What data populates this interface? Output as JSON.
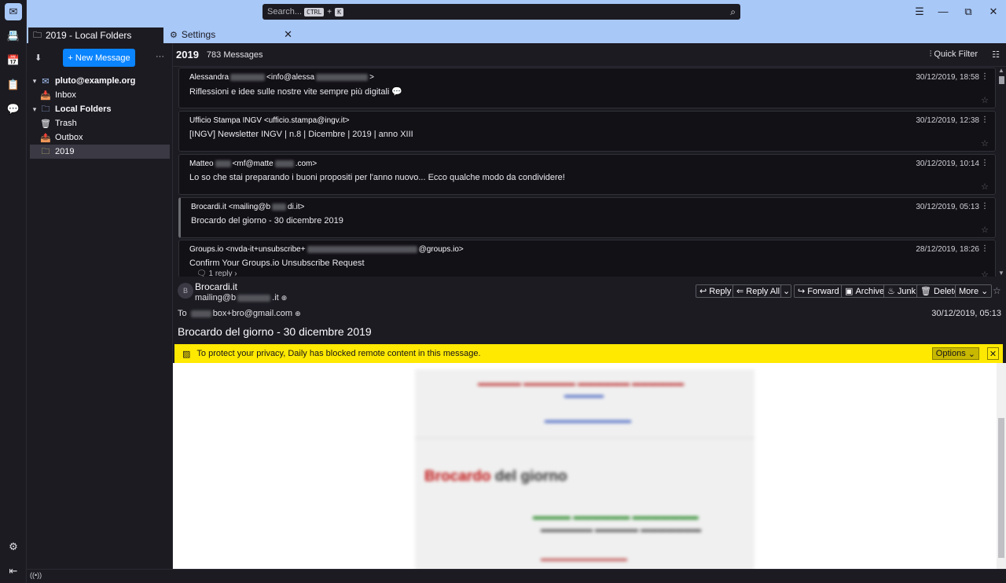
{
  "window": {
    "search_placeholder": "Search...",
    "shortcut_ctrl": "CTRL",
    "shortcut_plus": "+",
    "shortcut_key": "K",
    "menu_icon": "☰",
    "min_icon": "—",
    "max_icon": "⧉",
    "close_icon": "✕"
  },
  "spaces": {
    "mail": "✉",
    "address_book": "📇",
    "calendar": "📅",
    "tasks": "📋",
    "chat": "💬",
    "settings": "⚙",
    "collapse": "⇤"
  },
  "tabs": [
    {
      "label": "2019 - Local Folders",
      "icon": "🗀"
    },
    {
      "label": "Settings",
      "icon": "⚙",
      "close": "✕"
    }
  ],
  "folderpane": {
    "get_messages_icon": "⬇",
    "new_message": "+ New Message",
    "more": "···",
    "folders": [
      {
        "label": "pluto@example.org",
        "icon": "✉",
        "twisty": "▾",
        "bold": true
      },
      {
        "label": "Inbox",
        "icon": "📥",
        "twisty": "",
        "bold": false
      },
      {
        "label": "Local Folders",
        "icon": "🗀",
        "twisty": "▾",
        "bold": true
      },
      {
        "label": "Trash",
        "icon": "🗑",
        "twisty": "",
        "bold": false
      },
      {
        "label": "Outbox",
        "icon": "📤",
        "twisty": "",
        "bold": false
      },
      {
        "label": "2019",
        "icon": "🗀",
        "twisty": "",
        "bold": false
      }
    ]
  },
  "threadpane": {
    "folder_name": "2019",
    "count": "783 Messages",
    "quick_filter": "Quick Filter",
    "messages": [
      {
        "from_a": "Alessandra",
        "from_b": "<info@alessa",
        "from_c": ">",
        "subject": "Riflessioni e idee sulle nostre vite sempre più digitali",
        "date": "30/12/2019, 18:58"
      },
      {
        "from_a": "Ufficio Stampa INGV <ufficio.stampa@ingv.it>",
        "from_b": "",
        "from_c": "",
        "subject": "[INGV] Newsletter INGV | n.8 | Dicembre | 2019 | anno XIII",
        "date": "30/12/2019, 12:38"
      },
      {
        "from_a": "Matteo",
        "from_b": "<mf@matte",
        "from_c": ".com>",
        "subject": "Lo so che stai preparando i buoni propositi per l'anno nuovo... Ecco qualche modo da condividere!",
        "date": "30/12/2019, 10:14"
      },
      {
        "from_a": "Brocardi.it <mailing@b",
        "from_b": "di.it>",
        "from_c": "",
        "subject": "Brocardo del giorno - 30 dicembre 2019",
        "date": "30/12/2019, 05:13"
      },
      {
        "from_a": "Groups.io <nvda-it+unsubscribe+",
        "from_b": "@groups.io>",
        "from_c": "",
        "subject": "Confirm Your Groups.io Unsubscribe Request",
        "date": "28/12/2019, 18:26",
        "reply": "1 reply"
      }
    ]
  },
  "message": {
    "avatar": "B",
    "sender_name": "Brocardi.it",
    "sender_mail_a": "mailing@b",
    "sender_mail_b": ".it",
    "actions": {
      "reply": "Reply",
      "reply_all": "Reply All",
      "forward": "Forward",
      "archive": "Archive",
      "junk": "Junk",
      "delete": "Delete",
      "more": "More"
    },
    "to_label": "To",
    "to_value": "box+bro@gmail.com",
    "date": "30/12/2019, 05:13",
    "subject": "Brocardo del giorno - 30 dicembre 2019",
    "notice": "To protect your privacy, Daily has blocked remote content in this message.",
    "options": "Options",
    "body_title_red": "Brocardo",
    "body_title_rest": " del giorno"
  },
  "colors": {
    "accent": "#a8c8f8",
    "button": "#0a84ff",
    "notice": "#ffe900"
  }
}
